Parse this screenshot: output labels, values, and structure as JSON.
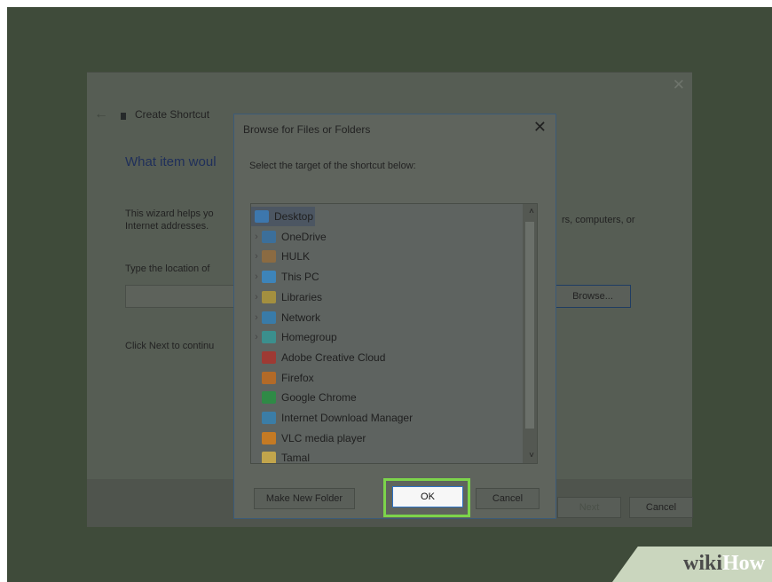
{
  "wizard": {
    "close_glyph": "✕",
    "back_glyph": "←",
    "title": "Create Shortcut",
    "heading": "What item woul",
    "desc_line1": "This wizard helps yo",
    "desc_line2": "Internet addresses.",
    "desc_right": "rs, computers, or",
    "type_label": "Type the location of",
    "browse_label": "Browse...",
    "click_next": "Click Next to continu",
    "next_label": "Next",
    "cancel_label": "Cancel"
  },
  "dialog": {
    "title": "Browse for Files or Folders",
    "close_glyph": "✕",
    "prompt": "Select the target of the shortcut below:",
    "tree": [
      {
        "label": "Desktop",
        "expandable": false,
        "selected": true,
        "icon": "desktop-icon",
        "color": "#3d77ad"
      },
      {
        "label": "OneDrive",
        "expandable": true,
        "selected": false,
        "icon": "onedrive-icon",
        "color": "#3c6f9a"
      },
      {
        "label": "HULK",
        "expandable": true,
        "selected": false,
        "icon": "user-icon",
        "color": "#8b6b42"
      },
      {
        "label": "This PC",
        "expandable": true,
        "selected": false,
        "icon": "pc-icon",
        "color": "#3d84b9"
      },
      {
        "label": "Libraries",
        "expandable": true,
        "selected": false,
        "icon": "libraries-icon",
        "color": "#a38f3f"
      },
      {
        "label": "Network",
        "expandable": true,
        "selected": false,
        "icon": "network-icon",
        "color": "#397ba8"
      },
      {
        "label": "Homegroup",
        "expandable": true,
        "selected": false,
        "icon": "homegroup-icon",
        "color": "#3b8f8d"
      },
      {
        "label": "Adobe Creative Cloud",
        "expandable": false,
        "selected": false,
        "icon": "adobe-cc-icon",
        "color": "#9e3a34"
      },
      {
        "label": "Firefox",
        "expandable": false,
        "selected": false,
        "icon": "firefox-icon",
        "color": "#b26a28"
      },
      {
        "label": "Google Chrome",
        "expandable": false,
        "selected": false,
        "icon": "chrome-icon",
        "color": "#2f8a46"
      },
      {
        "label": "Internet Download Manager",
        "expandable": false,
        "selected": false,
        "icon": "idm-icon",
        "color": "#3b7da6"
      },
      {
        "label": "VLC media player",
        "expandable": false,
        "selected": false,
        "icon": "vlc-icon",
        "color": "#c47a24"
      },
      {
        "label": "Tamal",
        "expandable": false,
        "selected": false,
        "icon": "folder-icon",
        "color": "#c2a54c"
      }
    ],
    "expand_glyph": "›",
    "scroll_up_glyph": "˄",
    "scroll_down_glyph": "˅",
    "new_folder_label": "Make New Folder",
    "ok_label": "OK",
    "cancel_label": "Cancel"
  },
  "watermark": {
    "wiki": "wiki",
    "how": "How"
  },
  "colors": {
    "background": "#3f4b3a",
    "ok_highlight": "#7cd44b",
    "ok_border": "#2f72c4"
  }
}
